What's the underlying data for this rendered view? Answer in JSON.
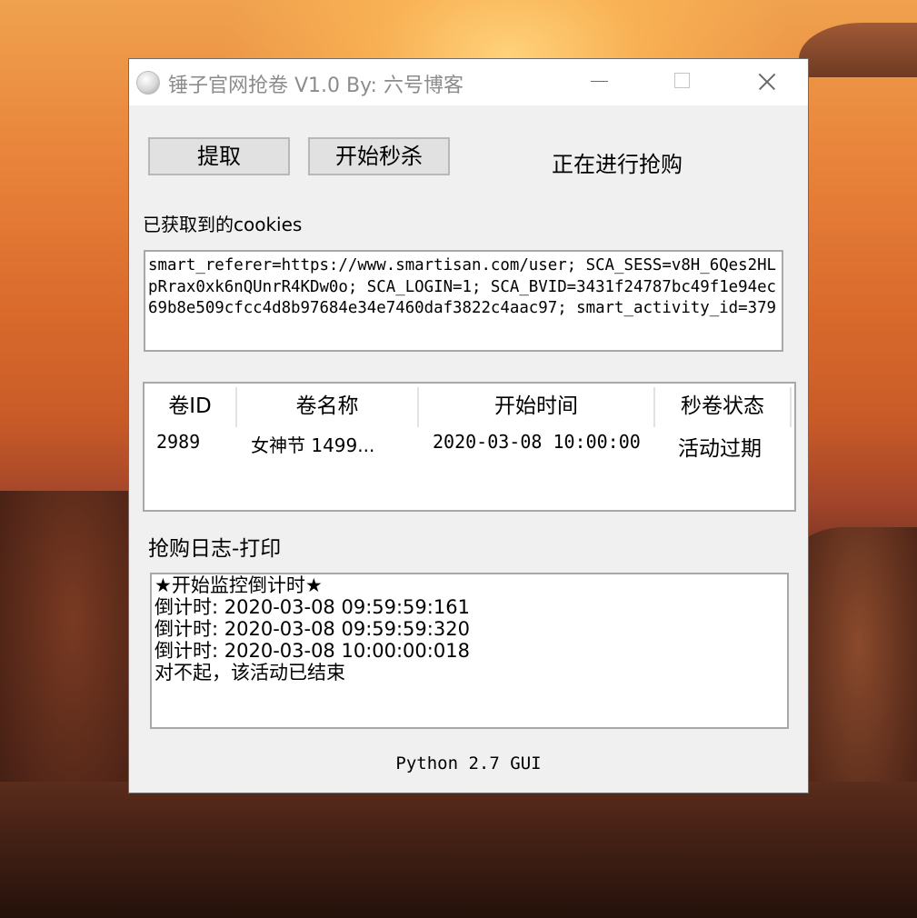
{
  "window": {
    "title": "锤子官网抢卷 V1.0  By: 六号博客"
  },
  "controls": {
    "extract_label": "提取",
    "start_label": "开始秒杀",
    "status_text": "正在进行抢购"
  },
  "cookies": {
    "label": "已获取到的cookies",
    "value": "smart_referer=https://www.smartisan.com/user; SCA_SESS=v8H_6Qes2HLpRrax0xk6nQUnrR4KDw0o; SCA_LOGIN=1; SCA_BVID=3431f24787bc49f1e94ec69b8e509cfcc4d8b97684e34e7460daf3822c4aac97; smart_activity_id=379"
  },
  "coupon_table": {
    "columns": [
      "卷ID",
      "卷名称",
      "开始时间",
      "秒卷状态"
    ],
    "rows": [
      [
        "2989",
        "女神节 1499...",
        "2020-03-08 10:00:00",
        "活动过期"
      ]
    ]
  },
  "log": {
    "label": "抢购日志-打印",
    "lines": [
      "★开始监控倒计时★",
      "倒计时: 2020-03-08 09:59:59:161",
      "倒计时: 2020-03-08 09:59:59:320",
      "倒计时: 2020-03-08 10:00:00:018",
      "对不起，该活动已结束"
    ]
  },
  "footer": {
    "text": "Python 2.7 GUI"
  }
}
